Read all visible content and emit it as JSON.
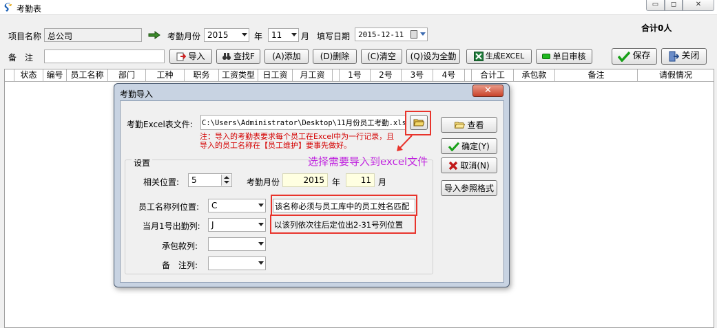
{
  "window": {
    "title": "考勤表",
    "min": "▭",
    "max": "◻",
    "close": "✕"
  },
  "header": {
    "project_label": "项目名称",
    "project_value": "总公司",
    "month_label": "考勤月份",
    "year_value": "2015",
    "year_unit": "年",
    "month_value": "11",
    "month_unit": "月",
    "date_label": "填写日期",
    "date_value": "2015-12-11",
    "total": "合计0人",
    "remark_label": "备　注",
    "remark_value": ""
  },
  "toolbar": {
    "import": "导入",
    "find": "查找F",
    "add": "(A)添加",
    "delete": "(D)删除",
    "clear": "(C)清空",
    "set_all": "(Q)设为全勤",
    "gen_excel": "生成EXCEL",
    "approve": "单日审核",
    "save": "保存",
    "close": "关闭"
  },
  "grid": {
    "columns": [
      "状态",
      "编号",
      "员工名称",
      "部门",
      "工种",
      "职务",
      "工资类型",
      "日工资",
      "月工资",
      "1号",
      "2号",
      "3号",
      "4号",
      "合计工",
      "承包款",
      "备注",
      "请假情况"
    ]
  },
  "dialog": {
    "title": "考勤导入",
    "close": "✕",
    "file_label": "考勤Excel表文件:",
    "file_value": "C:\\Users\\Administrator\\Desktop\\11月份员工考勤.xls",
    "note_line1": "注：导入的考勤表要求每个员工在Excel中为一行记录，且",
    "note_line2": "导入的员工名称在【员工维护】要事先做好。",
    "hint_select": "选择需要导入到excel文件",
    "settings_legend": "设置",
    "rel_pos_label": "相关位置:",
    "rel_pos_value": "5",
    "month_label": "考勤月份",
    "year_value": "2015",
    "year_unit": "年",
    "month_value": "11",
    "month_unit": "月",
    "name_col_label": "员工名称列位置:",
    "name_col_value": "C",
    "name_col_hint": "该名称必须与员工库中的员工姓名匹配",
    "day1_col_label": "当月1号出勤列:",
    "day1_col_value": "J",
    "day1_col_hint": "以该列依次往后定位出2-31号列位置",
    "contract_col_label": "承包款列:",
    "contract_col_value": "",
    "remark_col_label": "备　注列:",
    "remark_col_value": "",
    "btn_view": "查看",
    "btn_ok": "确定(Y)",
    "btn_cancel": "取消(N)",
    "btn_format": "导入参照格式"
  },
  "colors": {
    "accent_red": "#e8342c",
    "note_red": "#d40000",
    "hint_magenta": "#c020e0",
    "dialog_frame": "#c8d3e2"
  }
}
